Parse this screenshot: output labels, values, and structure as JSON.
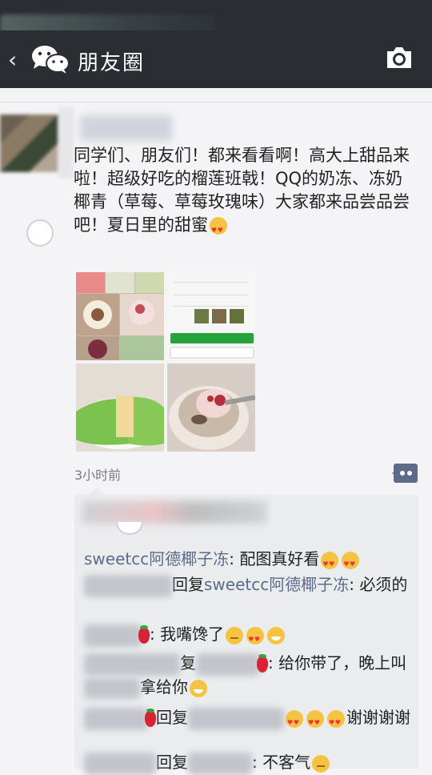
{
  "nav": {
    "back_label": "‹",
    "title": "朋友圈"
  },
  "post": {
    "text": "同学们、朋友们！都来看看啊！高大上甜品来啦！超级好吃的榴莲班戟！QQ的奶冻、冻奶椰青（草莓、草莓玫瑰味）大家都来品尝品尝吧！夏日里的甜蜜",
    "time": "3小时前",
    "images": [
      {
        "icon": "dessert-collage"
      },
      {
        "icon": "order-screenshot"
      },
      {
        "icon": "durian-pancake"
      },
      {
        "icon": "coconut-jelly"
      }
    ]
  },
  "comments": [
    {
      "author": "sweetcc阿德椰子冻",
      "sep": ": ",
      "text": "配图真好看",
      "emojis": [
        "love",
        "love"
      ]
    },
    {
      "reply_word": "回复",
      "target": "sweetcc阿德椰子冻",
      "sep": ": ",
      "text": "必须的"
    },
    {
      "sep": ": ",
      "text": "我嘴馋了",
      "emojis": [
        "sweat",
        "love",
        "grin"
      ]
    },
    {
      "reply_word": "复",
      "sep": ": ",
      "text": "给你带了，晚上叫",
      "text2": "拿给你",
      "emojis": [
        "grin"
      ]
    },
    {
      "reply_word": "回复",
      "text": "谢谢谢谢"
    },
    {
      "reply_word": "回复",
      "sep": ": ",
      "text": "不客气"
    }
  ]
}
